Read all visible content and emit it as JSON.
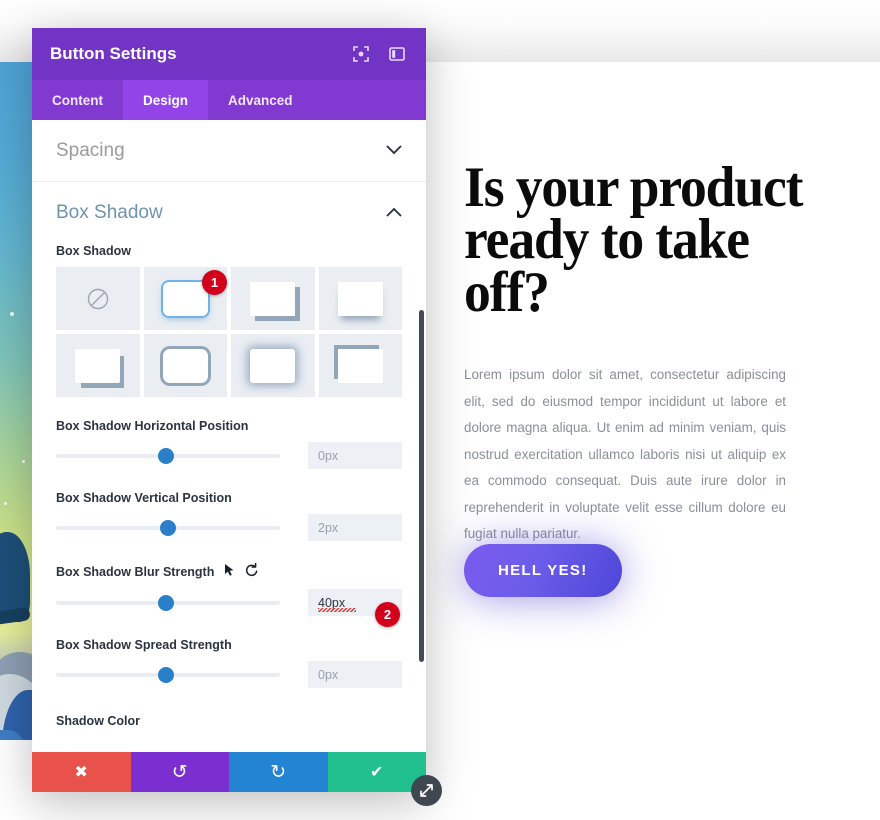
{
  "modal": {
    "title": "Button Settings",
    "header_icons": [
      {
        "name": "focus-target-icon"
      },
      {
        "name": "layout-panel-icon"
      }
    ],
    "tabs": [
      {
        "label": "Content",
        "active": false
      },
      {
        "label": "Design",
        "active": true
      },
      {
        "label": "Advanced",
        "active": false
      }
    ],
    "sections": {
      "spacing": {
        "label": "Spacing",
        "state": "collapsed",
        "chevron": "chevron-down-icon"
      },
      "box_shadow": {
        "label": "Box Shadow",
        "state": "expanded",
        "chevron": "chevron-up-icon"
      }
    },
    "box_shadow": {
      "preset_label": "Box Shadow",
      "presets": [
        {
          "name": "none",
          "selected": false
        },
        {
          "name": "soft-outline",
          "selected": true
        },
        {
          "name": "bottom-right-hard",
          "selected": false
        },
        {
          "name": "bottom-soft",
          "selected": false
        },
        {
          "name": "bottom-right-offset",
          "selected": false
        },
        {
          "name": "all-around-thick",
          "selected": false
        },
        {
          "name": "diffuse-glow",
          "selected": false
        },
        {
          "name": "top-left-corner",
          "selected": false
        }
      ],
      "sliders": [
        {
          "label": "Box Shadow Horizontal Position",
          "value": "0px",
          "filled": false,
          "knob_pct": 49
        },
        {
          "label": "Box Shadow Vertical Position",
          "value": "2px",
          "filled": false,
          "knob_pct": 50
        },
        {
          "label": "Box Shadow Blur Strength",
          "value": "40px",
          "filled": true,
          "knob_pct": 49,
          "has_cursor": true,
          "has_reset": true
        },
        {
          "label": "Box Shadow Spread Strength",
          "value": "0px",
          "filled": false,
          "knob_pct": 49
        }
      ],
      "shadow_color_label": "Shadow Color"
    },
    "badges": [
      {
        "text": "1"
      },
      {
        "text": "2"
      }
    ],
    "footer_buttons": [
      {
        "name": "cancel-button",
        "glyph": "✖",
        "color": "#e8524a"
      },
      {
        "name": "undo-button",
        "glyph": "↺",
        "color": "#7b2fd0"
      },
      {
        "name": "redo-button",
        "glyph": "↻",
        "color": "#2384d4"
      },
      {
        "name": "save-button",
        "glyph": "✔",
        "color": "#22c08f"
      }
    ],
    "resize_handle": {
      "name": "resize-handle-icon",
      "glyph": "⤡"
    }
  },
  "page": {
    "headline": "Is your product ready to take off?",
    "paragraph": "Lorem ipsum dolor sit amet, consectetur adipiscing elit, sed do eiusmod tempor incididunt ut labore et dolore magna aliqua. Ut enim ad minim veniam, quis nostrud exercitation ullamco laboris nisi ut aliquip ex ea commodo consequat. Duis aute irure dolor in reprehenderit in voluptate velit esse cillum dolore eu fugiat nulla pariatur.",
    "cta_label": "HELL YES!"
  },
  "colors": {
    "modal_header": "#7134c4",
    "tab_bar": "#8239d1",
    "tab_active": "#9244e8",
    "section_active": "#6f93ae",
    "slider_knob": "#2a7fc9",
    "badge": "#d3001b",
    "cta_gradient_from": "#7b5cf0",
    "cta_gradient_to": "#4e46d8"
  }
}
